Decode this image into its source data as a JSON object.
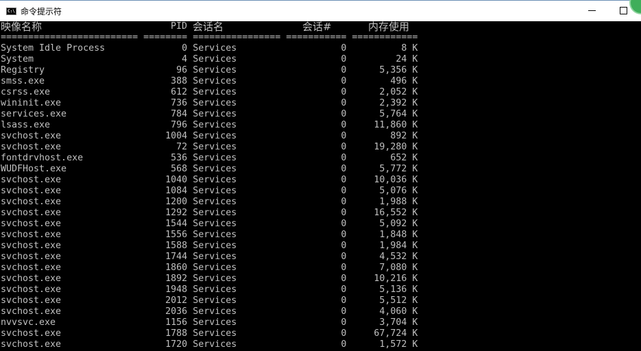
{
  "window": {
    "title": "命令提示符",
    "icon": "cmd-icon",
    "buttons": [
      "minimize",
      "maximize"
    ]
  },
  "console": {
    "headers": {
      "image_name": "映像名称",
      "pid": "PID",
      "session_name": "会话名",
      "session_num": "会话#",
      "mem_usage": "内存使用"
    },
    "separator": "========================= ======== ================ =========== ============",
    "rows": [
      [
        "System Idle Process",
        "0",
        "Services",
        "0",
        "8 K"
      ],
      [
        "System",
        "4",
        "Services",
        "0",
        "24 K"
      ],
      [
        "Registry",
        "96",
        "Services",
        "0",
        "5,356 K"
      ],
      [
        "smss.exe",
        "388",
        "Services",
        "0",
        "496 K"
      ],
      [
        "csrss.exe",
        "612",
        "Services",
        "0",
        "2,052 K"
      ],
      [
        "wininit.exe",
        "736",
        "Services",
        "0",
        "2,392 K"
      ],
      [
        "services.exe",
        "784",
        "Services",
        "0",
        "5,764 K"
      ],
      [
        "lsass.exe",
        "796",
        "Services",
        "0",
        "11,860 K"
      ],
      [
        "svchost.exe",
        "1004",
        "Services",
        "0",
        "892 K"
      ],
      [
        "svchost.exe",
        "72",
        "Services",
        "0",
        "19,280 K"
      ],
      [
        "fontdrvhost.exe",
        "536",
        "Services",
        "0",
        "652 K"
      ],
      [
        "WUDFHost.exe",
        "568",
        "Services",
        "0",
        "5,772 K"
      ],
      [
        "svchost.exe",
        "1040",
        "Services",
        "0",
        "10,036 K"
      ],
      [
        "svchost.exe",
        "1084",
        "Services",
        "0",
        "5,076 K"
      ],
      [
        "svchost.exe",
        "1200",
        "Services",
        "0",
        "1,988 K"
      ],
      [
        "svchost.exe",
        "1292",
        "Services",
        "0",
        "16,552 K"
      ],
      [
        "svchost.exe",
        "1544",
        "Services",
        "0",
        "5,092 K"
      ],
      [
        "svchost.exe",
        "1556",
        "Services",
        "0",
        "1,848 K"
      ],
      [
        "svchost.exe",
        "1588",
        "Services",
        "0",
        "1,984 K"
      ],
      [
        "svchost.exe",
        "1744",
        "Services",
        "0",
        "4,532 K"
      ],
      [
        "svchost.exe",
        "1860",
        "Services",
        "0",
        "7,080 K"
      ],
      [
        "svchost.exe",
        "1892",
        "Services",
        "0",
        "10,216 K"
      ],
      [
        "svchost.exe",
        "1948",
        "Services",
        "0",
        "5,136 K"
      ],
      [
        "svchost.exe",
        "2012",
        "Services",
        "0",
        "5,512 K"
      ],
      [
        "svchost.exe",
        "2036",
        "Services",
        "0",
        "4,060 K"
      ],
      [
        "nvvsvc.exe",
        "1156",
        "Services",
        "0",
        "3,704 K"
      ],
      [
        "svchost.exe",
        "1788",
        "Services",
        "0",
        "67,724 K"
      ],
      [
        "svchost.exe",
        "1720",
        "Services",
        "0",
        "1,572 K"
      ]
    ]
  }
}
